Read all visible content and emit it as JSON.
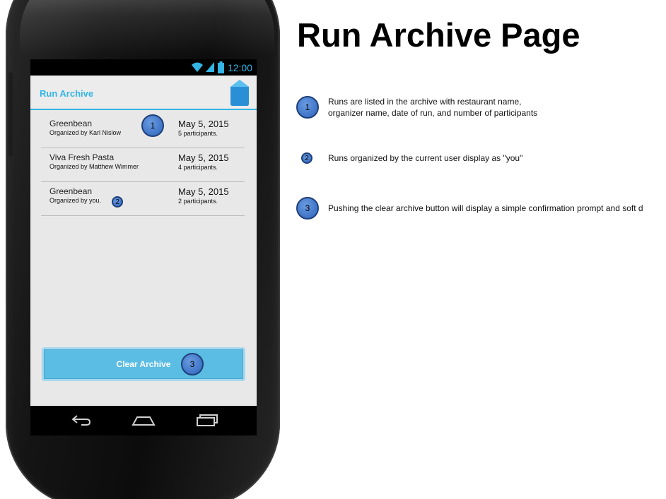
{
  "page": {
    "title": "Run Archive Page"
  },
  "device": {
    "status_time": "12:00"
  },
  "app": {
    "title": "Run Archive",
    "accent_color": "#33b5e5"
  },
  "runs": [
    {
      "restaurant": "Greenbean",
      "organizer": "Organized by Karl Nislow",
      "date": "May 5, 2015",
      "participants": "5 participants."
    },
    {
      "restaurant": "Viva Fresh Pasta",
      "organizer": "Organized by Matthew Wimmer",
      "date": "May 5, 2015",
      "participants": "4 participants."
    },
    {
      "restaurant": "Greenbean",
      "organizer": "Organized by you.",
      "date": "May 5, 2015",
      "participants": "2 participants."
    }
  ],
  "clear_button": {
    "label": "Clear Archive"
  },
  "markers": [
    "1",
    "2",
    "3"
  ],
  "notes": [
    {
      "number": "1",
      "lines": [
        "Runs are listed in the archive with restaurant name,",
        "organizer name, date of run, and number of participants"
      ]
    },
    {
      "number": "2",
      "lines": [
        "Runs organized by the current user display as \"you\""
      ]
    },
    {
      "number": "3",
      "lines": [
        "Pushing the clear archive button will display a simple confirmation prompt and soft d"
      ]
    }
  ],
  "icons": {
    "wifi": "wifi-icon",
    "signal": "signal-icon",
    "battery": "battery-icon",
    "back": "back-icon",
    "home": "home-icon",
    "recents": "recent-apps-icon",
    "app": "app-logo-icon"
  }
}
